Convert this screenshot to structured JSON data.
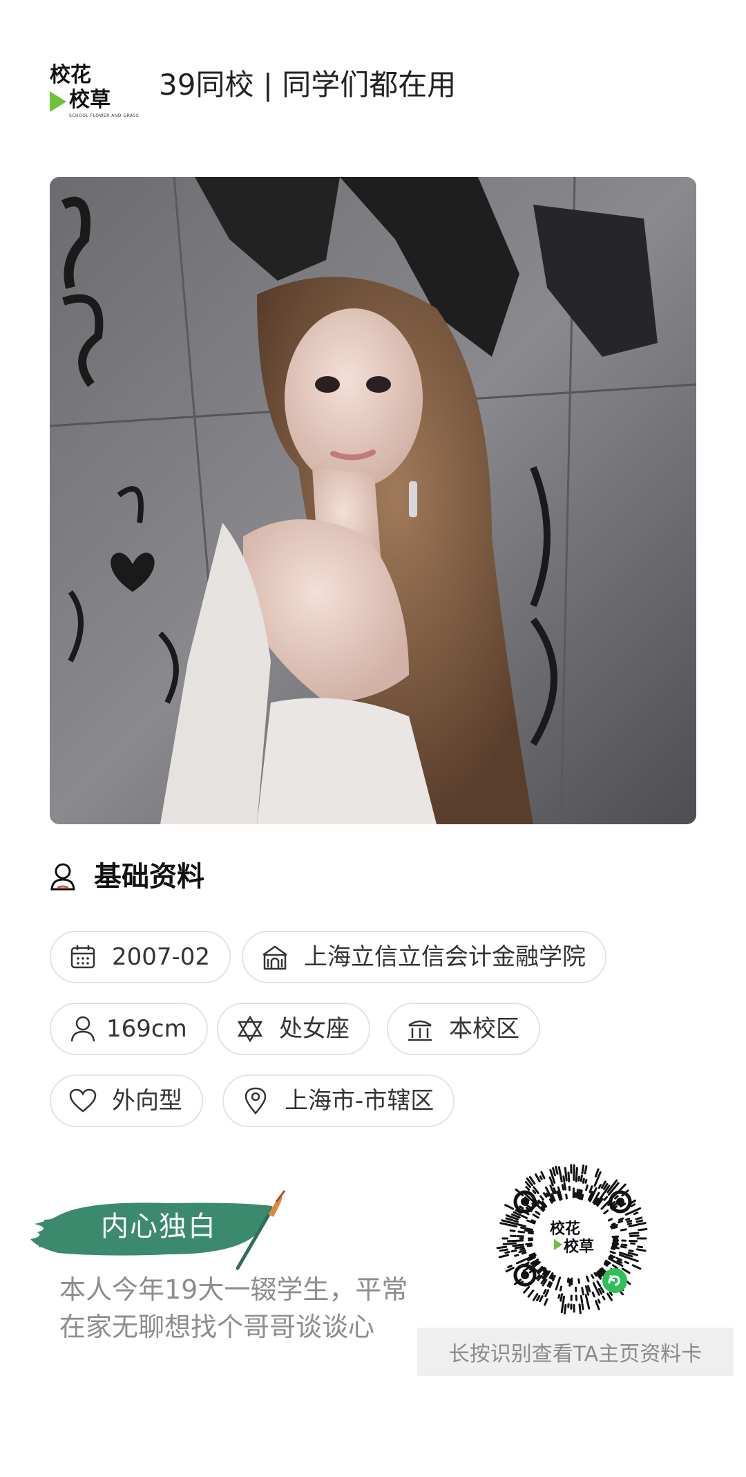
{
  "header": {
    "logo_line1": "校花",
    "logo_line2": "校草",
    "logo_tagline": "SCHOOL FLOWER AND GRASS",
    "title": "39同校 | 同学们都在用"
  },
  "profile_photo": {
    "icon": "profile-photo"
  },
  "basic_info": {
    "heading": "基础资料",
    "icon": "person-icon",
    "tags": [
      {
        "icon": "calendar-icon",
        "text": "2007-02"
      },
      {
        "icon": "school-building-icon",
        "text": "上海立信立信会计金融学院"
      },
      {
        "icon": "person-icon",
        "text": "169cm"
      },
      {
        "icon": "star-of-david-icon",
        "text": "处女座"
      },
      {
        "icon": "campus-gate-icon",
        "text": "本校区"
      },
      {
        "icon": "heart-icon",
        "text": "外向型"
      },
      {
        "icon": "location-pin-icon",
        "text": "上海市-市辖区"
      }
    ]
  },
  "monologue": {
    "heading": "内心独白",
    "text_line1": "本人今年19大一辍学生，平常",
    "text_line2": "在家无聊想找个哥哥谈谈心"
  },
  "qr": {
    "center_logo_line1": "校花",
    "center_logo_line2": "校草",
    "caption": "长按识别查看TA主页资料卡"
  },
  "colors": {
    "accent_green": "#3b8a6e",
    "qr_badge": "#2fbf5a",
    "chip_border": "#e3e3e3",
    "caption_bg": "#efefef"
  }
}
